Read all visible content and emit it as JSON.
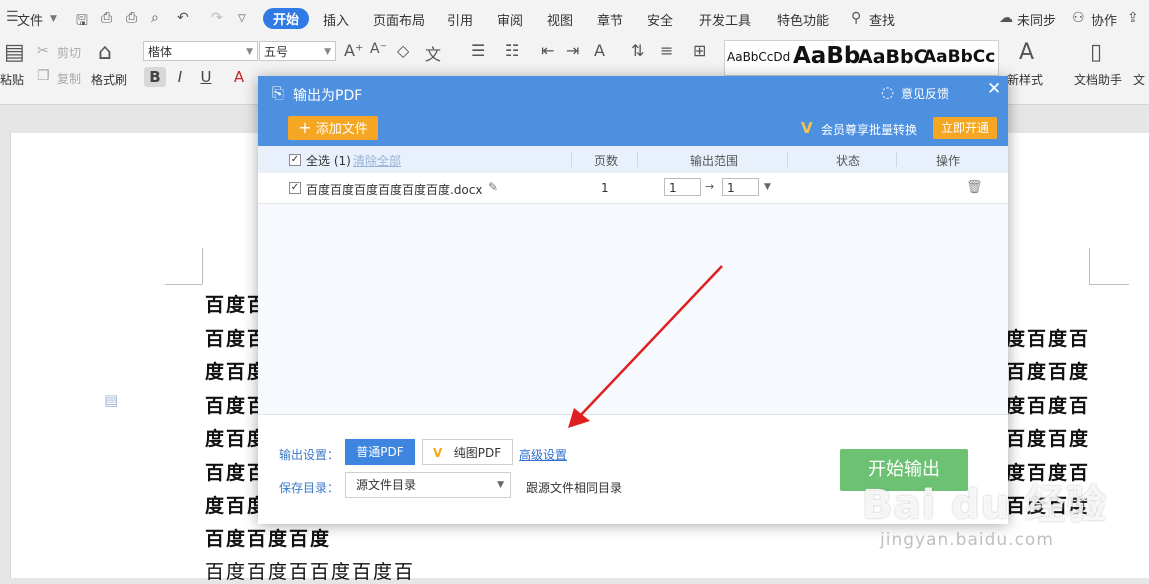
{
  "menubar": {
    "file": "文件",
    "tabs": [
      "开始",
      "插入",
      "页面布局",
      "引用",
      "审阅",
      "视图",
      "章节",
      "安全",
      "开发工具",
      "特色功能"
    ],
    "search": "查找",
    "sync": "未同步",
    "collab": "协作"
  },
  "toolbar": {
    "paste": "粘贴",
    "cut": "剪切",
    "copy": "复制",
    "format_painter": "格式刷",
    "font_name": "楷体",
    "font_size": "五号",
    "new_style": "新样式",
    "doc_assistant": "文档助手",
    "doc_translate": "文",
    "styles": [
      "AaBbCcDd",
      "AaBb",
      "AaBbC",
      "AaBbCc"
    ]
  },
  "document": {
    "lines": [
      "百度百",
      "百度百",
      "度百度",
      "百度百",
      "度百度",
      "百度百",
      "度百度",
      "百度百度百度",
      "百度百度百百度百度百"
    ],
    "right_lines": [
      "度百度百",
      "百度百度",
      "度百度百",
      "百度百度",
      "度百度百",
      "百度百度"
    ]
  },
  "dialog": {
    "title": "输出为PDF",
    "feedback": "意见反馈",
    "add_file": "添加文件",
    "member_note": "会员尊享批量转换",
    "open_vip": "立即开通",
    "select_all": "全选 (1)",
    "clear_all": "清除全部",
    "columns": {
      "pages": "页数",
      "range": "输出范围",
      "status": "状态",
      "action": "操作"
    },
    "file": {
      "name": "百度百度百度百度百度百度.docx",
      "pages": "1",
      "range_from": "1",
      "range_to": "1"
    },
    "output_settings_label": "输出设置：",
    "normal_pdf": "普通PDF",
    "image_pdf": "纯图PDF",
    "advanced": "高级设置",
    "save_dir_label": "保存目录：",
    "save_dir_value": "源文件目录",
    "save_dir_hint": "跟源文件相同目录",
    "start": "开始输出"
  },
  "watermark": {
    "logo": "Bai du 经验",
    "url": "jingyan.baidu.com"
  },
  "colors": {
    "accent": "#2f7ae5",
    "dialog_header": "#4e90e0",
    "orange": "#f5a623",
    "start": "#6cc173",
    "arrow": "#e02020"
  }
}
